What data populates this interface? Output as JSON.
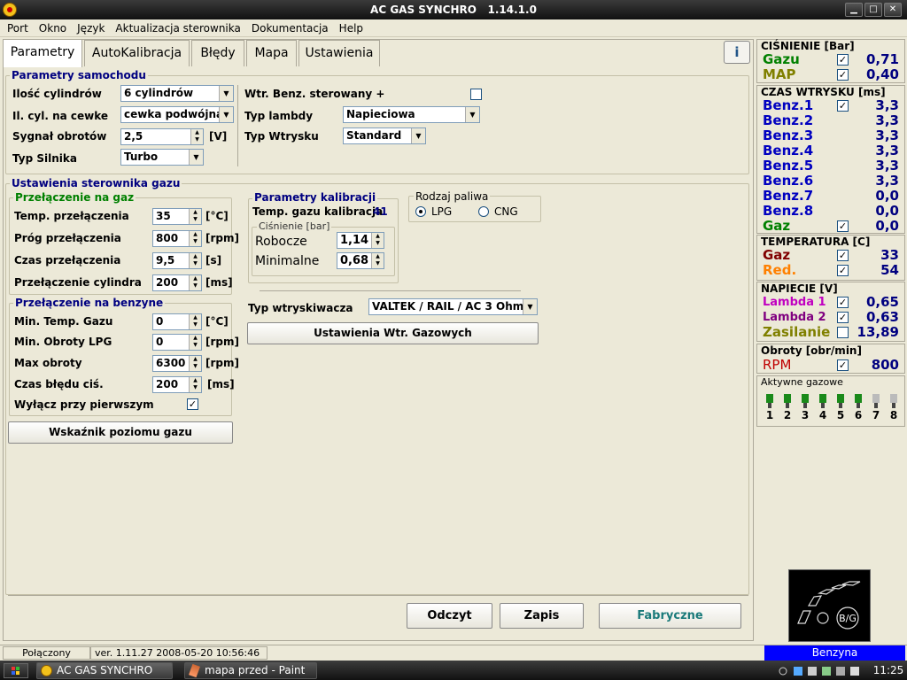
{
  "window": {
    "title": "AC GAS SYNCHRO",
    "version": "1.14.1.0",
    "min": "▁",
    "max": "□",
    "close": "✕"
  },
  "menu": [
    "Port",
    "Okno",
    "Język",
    "Aktualizacja sterownika",
    "Dokumentacja",
    "Help"
  ],
  "tabs": [
    "Parametry",
    "AutoKalibracja",
    "Błędy",
    "Mapa",
    "Ustawienia"
  ],
  "help_icon": "i",
  "params_car": {
    "title": "Parametry samochodu",
    "cyl_count_label": "Ilość cylindrów",
    "cyl_count_value": "6 cylindrów",
    "cyl_per_coil_label": "Il. cyl. na cewke",
    "cyl_per_coil_value": "cewka podwójna",
    "rpm_signal_label": "Sygnał obrotów",
    "rpm_signal_value": "2,5",
    "rpm_signal_unit": "[V]",
    "engine_type_label": "Typ Silnika",
    "engine_type_value": "Turbo",
    "wtr_benz_label": "Wtr. Benz. sterowany +",
    "lambda_type_label": "Typ lambdy",
    "lambda_type_value": "Napieciowa",
    "injection_type_label": "Typ Wtrysku",
    "injection_type_value": "Standard"
  },
  "controller": {
    "title": "Ustawienia sterownika gazu",
    "to_gas": {
      "title": "Przełączenie na gaz",
      "rows": [
        {
          "label": "Temp. przełączenia",
          "value": "35",
          "unit": "[°C]"
        },
        {
          "label": "Próg przełączenia",
          "value": "800",
          "unit": "[rpm]"
        },
        {
          "label": "Czas przełączenia",
          "value": "9,5",
          "unit": "[s]"
        },
        {
          "label": "Przełączenie cylindra",
          "value": "200",
          "unit": "[ms]"
        }
      ]
    },
    "to_petrol": {
      "title": "Przełączenie na benzyne",
      "rows": [
        {
          "label": "Min. Temp. Gazu",
          "value": "0",
          "unit": "[°C]"
        },
        {
          "label": "Min. Obroty LPG",
          "value": "0",
          "unit": "[rpm]"
        },
        {
          "label": "Max obroty",
          "value": "6300",
          "unit": "[rpm]"
        },
        {
          "label": "Czas błędu ciś.",
          "value": "200",
          "unit": "[ms]"
        }
      ],
      "off_first_label": "Wyłącz przy pierwszym"
    },
    "gas_level_button": "Wskaźnik poziomu gazu",
    "calibration": {
      "title": "Parametry kalibracji",
      "temp_label": "Temp. gazu kalibracja",
      "temp_value": "41",
      "pressure_title": "Ciśnienie [bar]",
      "working_label": "Robocze",
      "working_value": "1,14",
      "minimal_label": "Minimalne",
      "minimal_value": "0,68"
    },
    "fuel": {
      "title": "Rodzaj paliwa",
      "lpg": "LPG",
      "cng": "CNG"
    },
    "injector_label": "Typ wtryskiwacza",
    "injector_value": "VALTEK / RAIL / AC 3 Ohm",
    "gas_injector_settings_button": "Ustawienia Wtr. Gazowych"
  },
  "bottom_buttons": {
    "read": "Odczyt",
    "write": "Zapis",
    "factory": "Fabryczne"
  },
  "right": {
    "pressure": {
      "title": "CIŚNIENIE [Bar]",
      "rows": [
        {
          "label": "Gazu",
          "value": "0,71",
          "color": "#008000"
        },
        {
          "label": "MAP",
          "value": "0,40",
          "color": "#808000"
        }
      ]
    },
    "injection": {
      "title": "CZAS WTRYSKU  [ms]",
      "rows": [
        {
          "label": "Benz.1",
          "value": "3,3"
        },
        {
          "label": "Benz.2",
          "value": "3,3"
        },
        {
          "label": "Benz.3",
          "value": "3,3"
        },
        {
          "label": "Benz.4",
          "value": "3,3"
        },
        {
          "label": "Benz.5",
          "value": "3,3"
        },
        {
          "label": "Benz.6",
          "value": "3,3"
        },
        {
          "label": "Benz.7",
          "value": "0,0"
        },
        {
          "label": "Benz.8",
          "value": "0,0"
        },
        {
          "label": "Gaz",
          "value": "0,0"
        }
      ]
    },
    "temperature": {
      "title": "TEMPERATURA  [C]",
      "rows": [
        {
          "label": "Gaz",
          "value": "33",
          "color": "#800000"
        },
        {
          "label": "Red.",
          "value": "54",
          "color": "#ff8000"
        }
      ]
    },
    "voltage": {
      "title": "NAPIECIE [V]",
      "rows": [
        {
          "label": "Lambda 1",
          "value": "0,65",
          "color": "#c000c0"
        },
        {
          "label": "Lambda 2",
          "value": "0,63",
          "color": "#800080"
        },
        {
          "label": "Zasilanie",
          "value": "13,89",
          "color": "#808000"
        }
      ]
    },
    "rpm": {
      "title": "Obroty [obr/min]",
      "label": "RPM",
      "value": "800"
    },
    "active": {
      "title": "Aktywne gazowe",
      "nums": [
        "1",
        "2",
        "3",
        "4",
        "5",
        "6",
        "7",
        "8"
      ]
    },
    "bg_label": "B/G",
    "fuel_indicator": "Benzyna"
  },
  "status": {
    "connection": "Połączony",
    "ver": "ver. 1.11.27   2008-05-20  10:56:46"
  },
  "taskbar": {
    "task1": "AC GAS SYNCHRO",
    "task2": "mapa przed - Paint",
    "clock": "11:25"
  }
}
